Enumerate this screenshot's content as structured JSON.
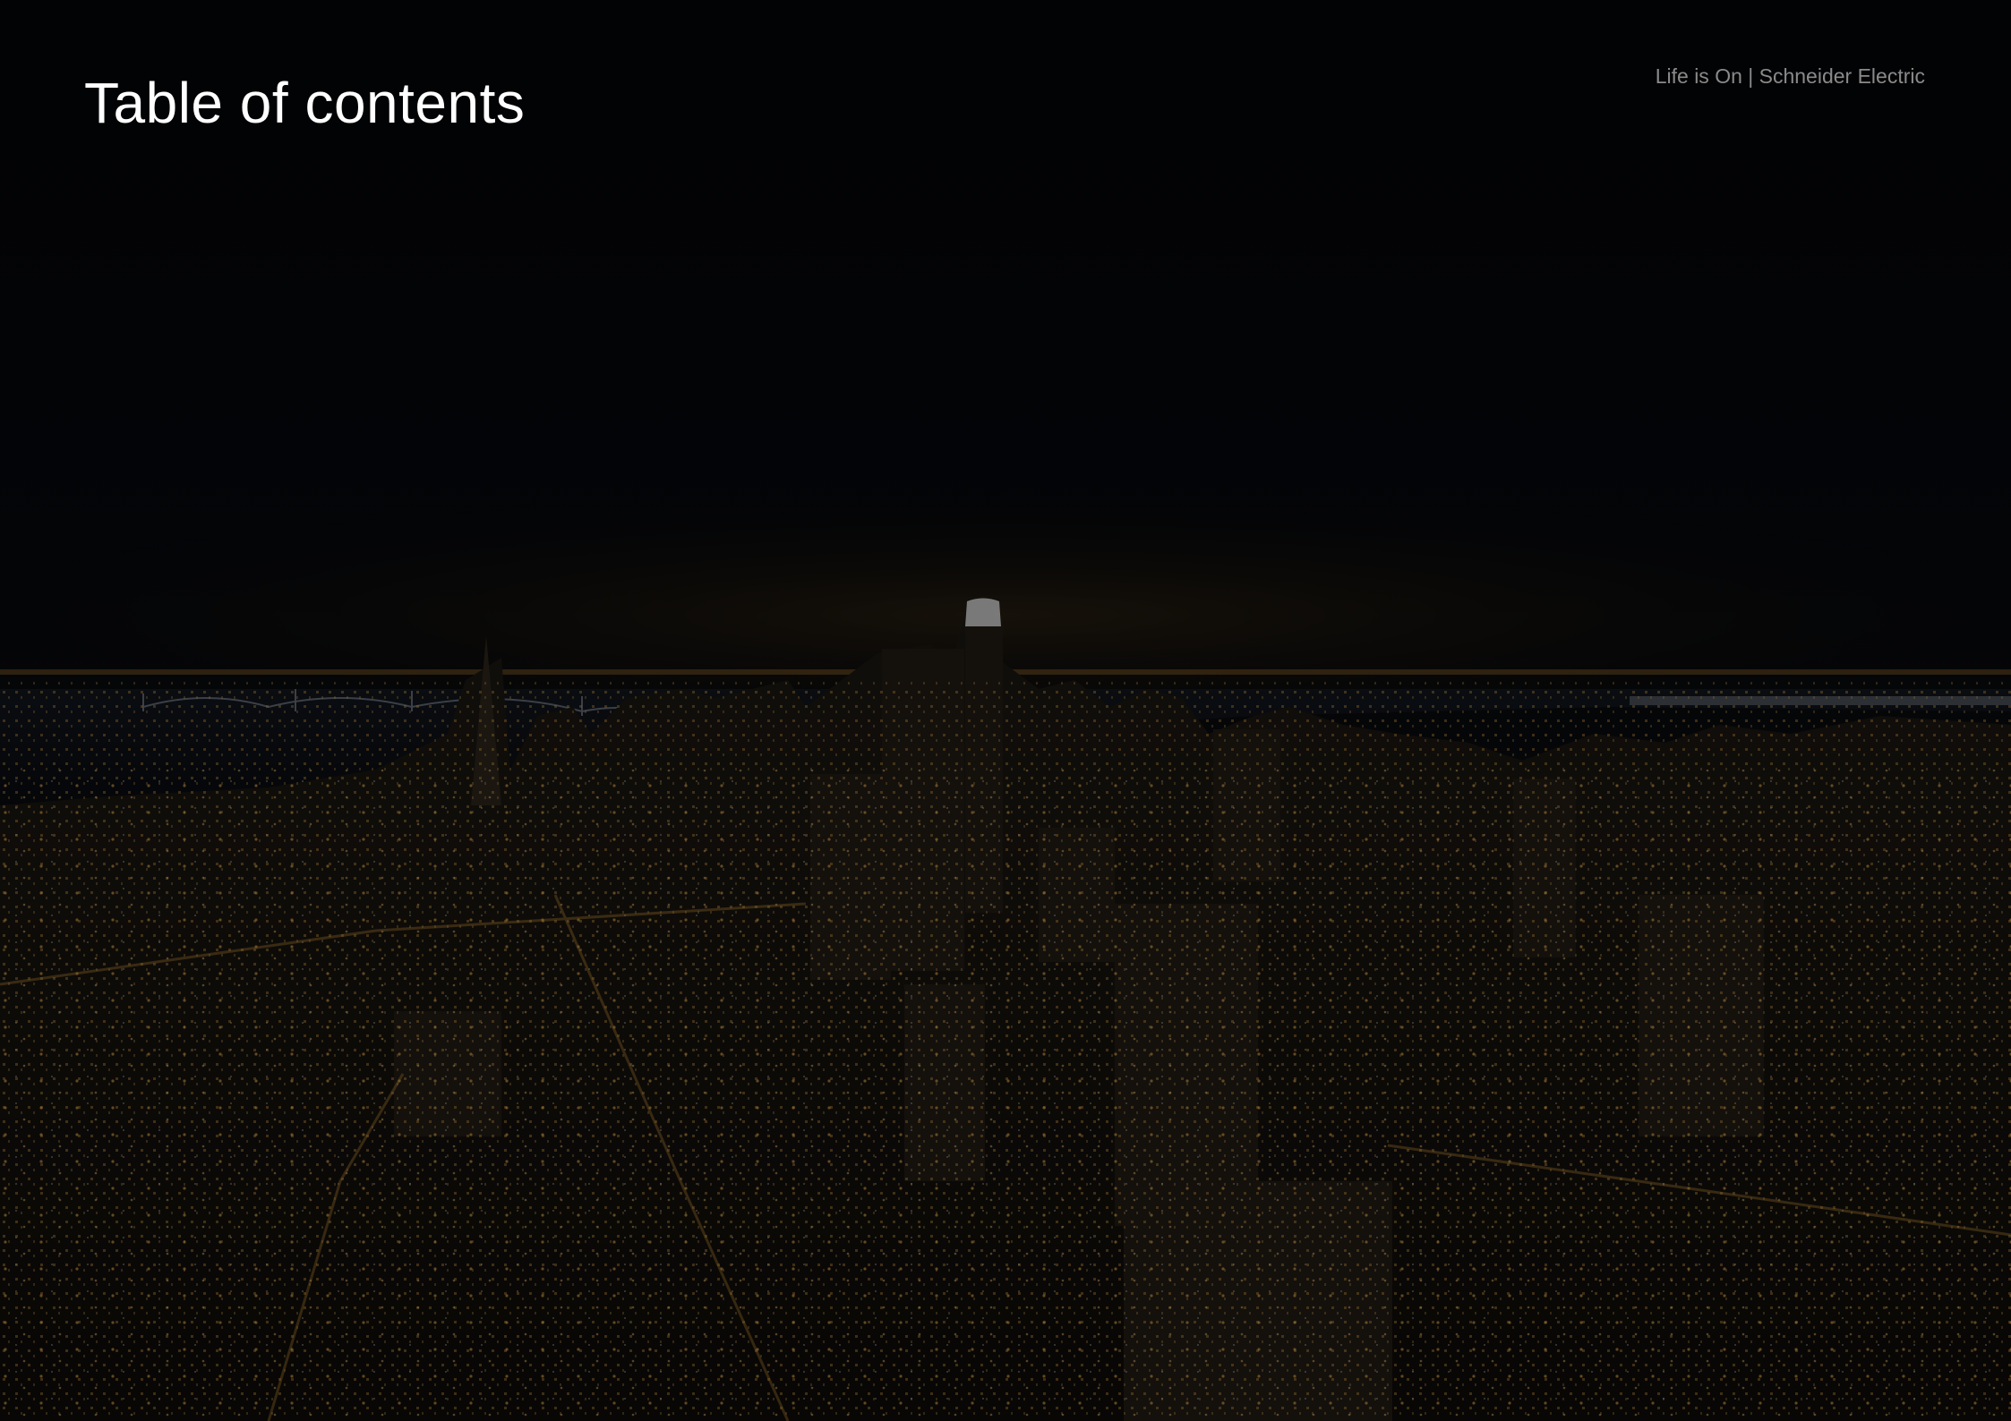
{
  "page": {
    "title": "Table of contents",
    "tagline": "Life is On | Schneider Electric",
    "background_image": "night-city-skyline-photo",
    "colors": {
      "background": "#050608",
      "title": "#ffffff",
      "tagline": "#8a8a8a",
      "city_lights": "#d9a24a"
    }
  }
}
